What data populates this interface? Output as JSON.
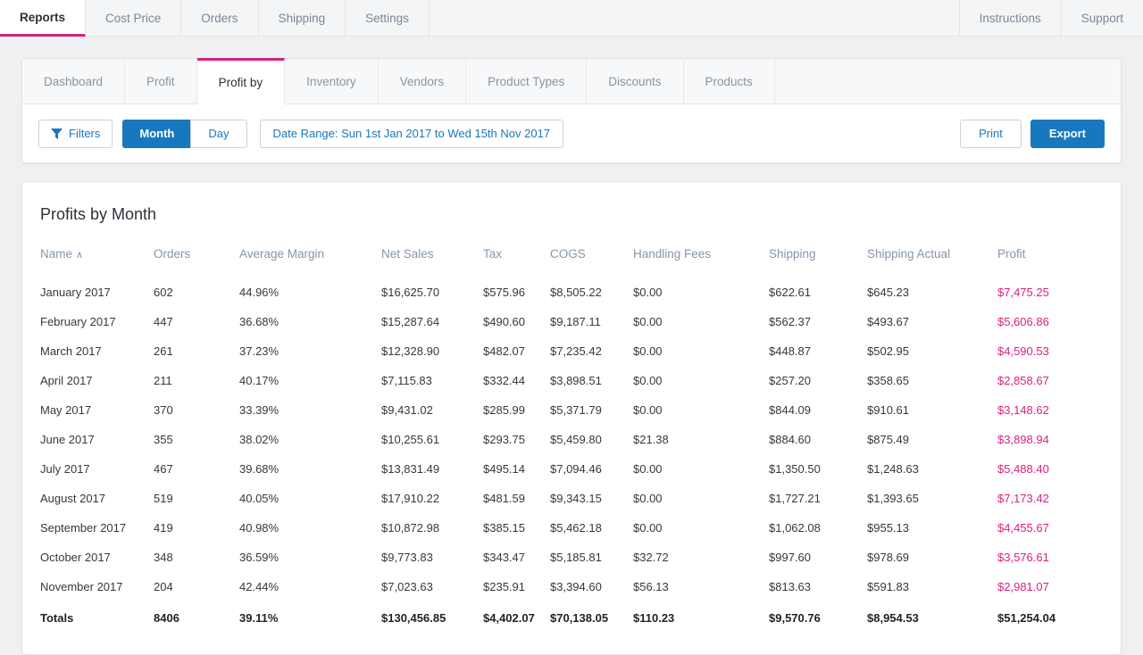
{
  "topnav": {
    "left": [
      {
        "label": "Reports",
        "active": true
      },
      {
        "label": "Cost Price",
        "active": false
      },
      {
        "label": "Orders",
        "active": false
      },
      {
        "label": "Shipping",
        "active": false
      },
      {
        "label": "Settings",
        "active": false
      }
    ],
    "right": [
      {
        "label": "Instructions"
      },
      {
        "label": "Support"
      }
    ]
  },
  "subtabs": [
    {
      "label": "Dashboard",
      "active": false
    },
    {
      "label": "Profit",
      "active": false
    },
    {
      "label": "Profit by",
      "active": true
    },
    {
      "label": "Inventory",
      "active": false
    },
    {
      "label": "Vendors",
      "active": false
    },
    {
      "label": "Product Types",
      "active": false
    },
    {
      "label": "Discounts",
      "active": false
    },
    {
      "label": "Products",
      "active": false
    }
  ],
  "toolbar": {
    "filters_label": "Filters",
    "month_label": "Month",
    "day_label": "Day",
    "active_period": "Month",
    "date_range_label": "Date Range: Sun 1st Jan 2017 to Wed 15th Nov 2017",
    "print_label": "Print",
    "export_label": "Export"
  },
  "colors": {
    "accent_pink": "#de1e80",
    "accent_blue": "#1878be",
    "page_bg": "#eff0f1",
    "header_text": "#8596ab"
  },
  "report": {
    "title": "Profits by Month",
    "sort_column": "Name",
    "sort_direction": "asc",
    "columns": [
      "Name",
      "Orders",
      "Average Margin",
      "Net Sales",
      "Tax",
      "COGS",
      "Handling Fees",
      "Shipping",
      "Shipping Actual",
      "Profit"
    ],
    "rows": [
      {
        "name": "January 2017",
        "orders": "602",
        "margin": "44.96%",
        "net_sales": "$16,625.70",
        "tax": "$575.96",
        "cogs": "$8,505.22",
        "handling": "$0.00",
        "shipping": "$622.61",
        "shipping_actual": "$645.23",
        "profit": "$7,475.25"
      },
      {
        "name": "February 2017",
        "orders": "447",
        "margin": "36.68%",
        "net_sales": "$15,287.64",
        "tax": "$490.60",
        "cogs": "$9,187.11",
        "handling": "$0.00",
        "shipping": "$562.37",
        "shipping_actual": "$493.67",
        "profit": "$5,606.86"
      },
      {
        "name": "March 2017",
        "orders": "261",
        "margin": "37.23%",
        "net_sales": "$12,328.90",
        "tax": "$482.07",
        "cogs": "$7,235.42",
        "handling": "$0.00",
        "shipping": "$448.87",
        "shipping_actual": "$502.95",
        "profit": "$4,590.53"
      },
      {
        "name": "April 2017",
        "orders": "211",
        "margin": "40.17%",
        "net_sales": "$7,115.83",
        "tax": "$332.44",
        "cogs": "$3,898.51",
        "handling": "$0.00",
        "shipping": "$257.20",
        "shipping_actual": "$358.65",
        "profit": "$2,858.67"
      },
      {
        "name": "May 2017",
        "orders": "370",
        "margin": "33.39%",
        "net_sales": "$9,431.02",
        "tax": "$285.99",
        "cogs": "$5,371.79",
        "handling": "$0.00",
        "shipping": "$844.09",
        "shipping_actual": "$910.61",
        "profit": "$3,148.62"
      },
      {
        "name": "June 2017",
        "orders": "355",
        "margin": "38.02%",
        "net_sales": "$10,255.61",
        "tax": "$293.75",
        "cogs": "$5,459.80",
        "handling": "$21.38",
        "shipping": "$884.60",
        "shipping_actual": "$875.49",
        "profit": "$3,898.94"
      },
      {
        "name": "July 2017",
        "orders": "467",
        "margin": "39.68%",
        "net_sales": "$13,831.49",
        "tax": "$495.14",
        "cogs": "$7,094.46",
        "handling": "$0.00",
        "shipping": "$1,350.50",
        "shipping_actual": "$1,248.63",
        "profit": "$5,488.40"
      },
      {
        "name": "August 2017",
        "orders": "519",
        "margin": "40.05%",
        "net_sales": "$17,910.22",
        "tax": "$481.59",
        "cogs": "$9,343.15",
        "handling": "$0.00",
        "shipping": "$1,727.21",
        "shipping_actual": "$1,393.65",
        "profit": "$7,173.42"
      },
      {
        "name": "September 2017",
        "orders": "419",
        "margin": "40.98%",
        "net_sales": "$10,872.98",
        "tax": "$385.15",
        "cogs": "$5,462.18",
        "handling": "$0.00",
        "shipping": "$1,062.08",
        "shipping_actual": "$955.13",
        "profit": "$4,455.67"
      },
      {
        "name": "October 2017",
        "orders": "348",
        "margin": "36.59%",
        "net_sales": "$9,773.83",
        "tax": "$343.47",
        "cogs": "$5,185.81",
        "handling": "$32.72",
        "shipping": "$997.60",
        "shipping_actual": "$978.69",
        "profit": "$3,576.61"
      },
      {
        "name": "November 2017",
        "orders": "204",
        "margin": "42.44%",
        "net_sales": "$7,023.63",
        "tax": "$235.91",
        "cogs": "$3,394.60",
        "handling": "$56.13",
        "shipping": "$813.63",
        "shipping_actual": "$591.83",
        "profit": "$2,981.07"
      }
    ],
    "totals": {
      "name": "Totals",
      "orders": "8406",
      "margin": "39.11%",
      "net_sales": "$130,456.85",
      "tax": "$4,402.07",
      "cogs": "$70,138.05",
      "handling": "$110.23",
      "shipping": "$9,570.76",
      "shipping_actual": "$8,954.53",
      "profit": "$51,254.04"
    }
  }
}
